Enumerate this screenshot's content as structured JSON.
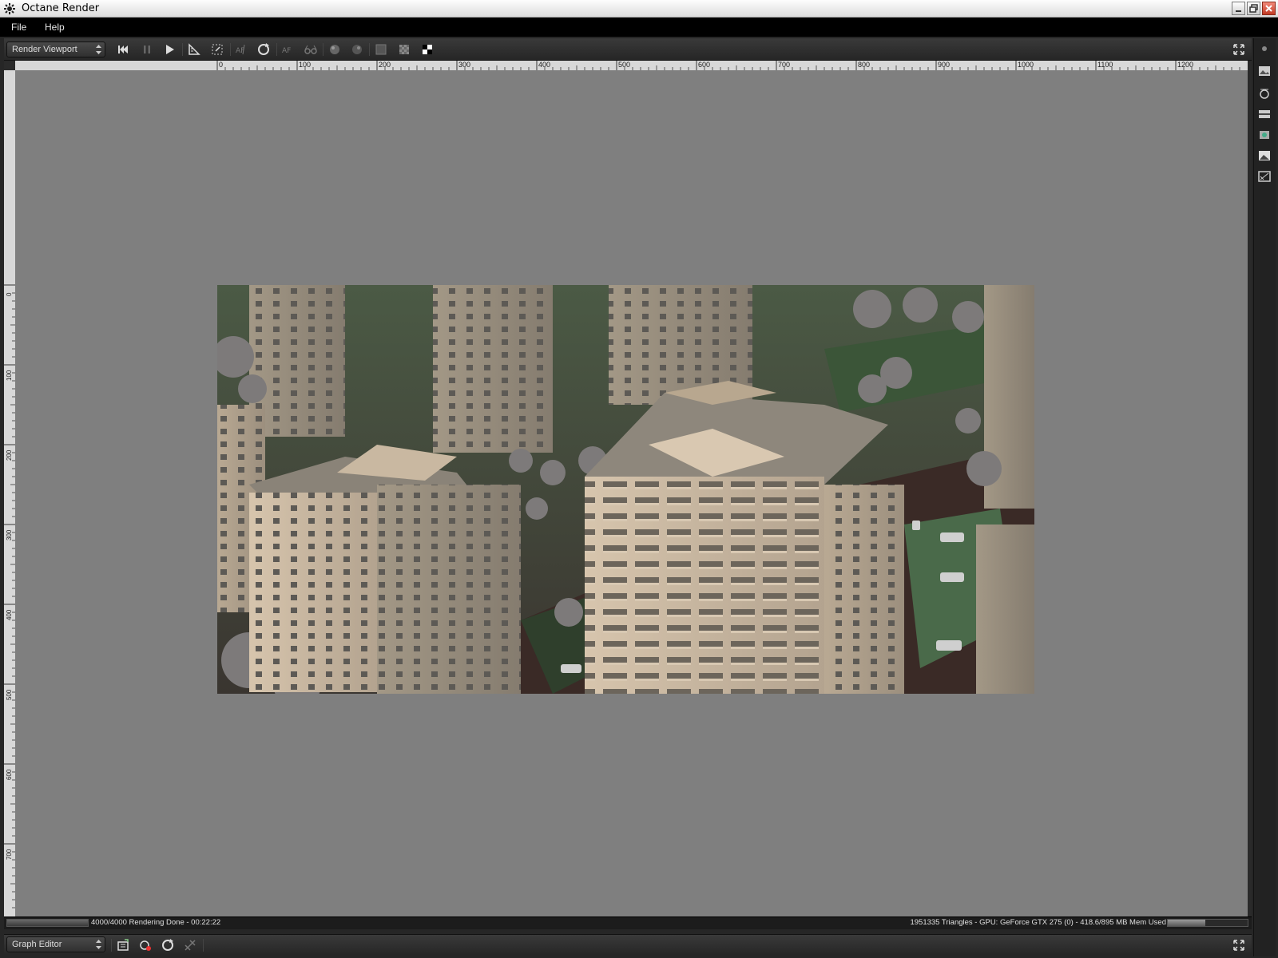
{
  "window": {
    "title": "Octane Render"
  },
  "menu": {
    "items": [
      {
        "label": "File"
      },
      {
        "label": "Help"
      }
    ]
  },
  "viewport": {
    "panel_select": "Render Viewport",
    "toolbar": [
      "rewind-icon",
      "pause-icon",
      "play-icon",
      "ruler-icon",
      "region-icon",
      "autofocus-icon",
      "refresh-icon",
      "af-icon",
      "glasses-icon",
      "sphere-icon",
      "sphere-alt-icon",
      "solid-bg-icon",
      "checker-bg-icon",
      "alpha-bg-icon"
    ]
  },
  "ruler": {
    "horizontal_labels": [
      "0",
      "100",
      "200",
      "300",
      "400",
      "500",
      "600",
      "700",
      "800",
      "900",
      "1000",
      "1100",
      "1200"
    ],
    "vertical_labels": [
      "0",
      "100",
      "200",
      "300",
      "400",
      "500",
      "600",
      "700"
    ]
  },
  "status": {
    "left": "4000/4000 Rendering Done - 00:22:22",
    "right": "1951335 Triangles - GPU: GeForce GTX 275 (0) - 418.6/895 MB Mem Used",
    "mem_fraction": 0.468
  },
  "graph_editor": {
    "panel_select": "Graph Editor"
  },
  "colors": {
    "canvas": "#7f7f7f",
    "menubar": "#000000",
    "toolbar": "#2e2e2e"
  }
}
